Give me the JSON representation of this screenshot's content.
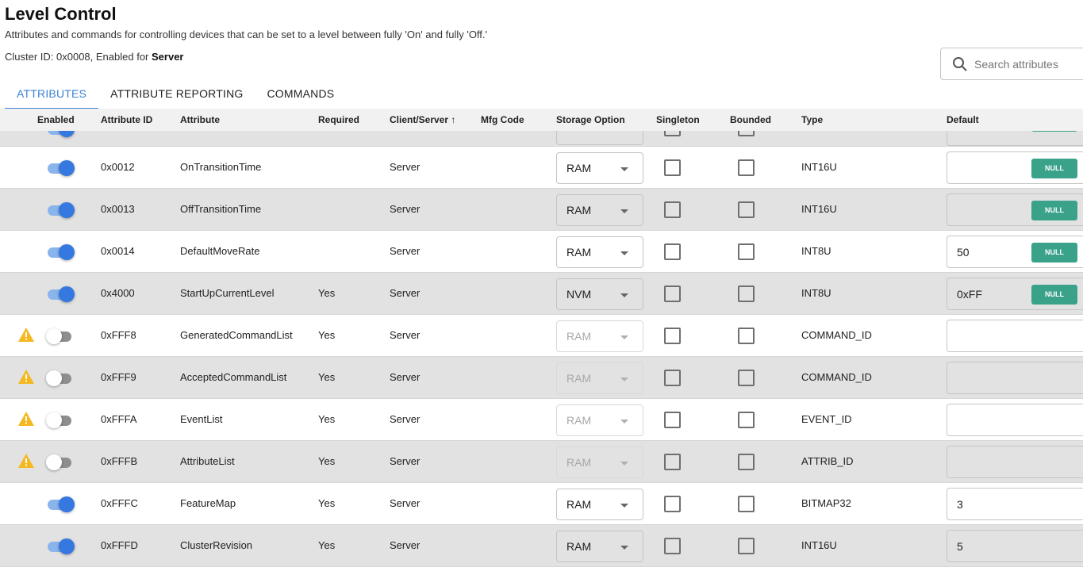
{
  "page": {
    "title": "Level Control",
    "description": "Attributes and commands for controlling devices that can be set to a level between fully 'On' and fully 'Off.'",
    "cluster_prefix": "Cluster ID: 0x0008, Enabled for ",
    "cluster_side": "Server"
  },
  "search": {
    "placeholder": "Search attributes",
    "icon": "search-icon"
  },
  "tabs": [
    {
      "label": "ATTRIBUTES",
      "active": true
    },
    {
      "label": "ATTRIBUTE REPORTING",
      "active": false
    },
    {
      "label": "COMMANDS",
      "active": false
    }
  ],
  "columns": {
    "enabled": "Enabled",
    "attribute_id": "Attribute ID",
    "attribute": "Attribute",
    "required": "Required",
    "client_server": "Client/Server ↑",
    "mfg_code": "Mfg Code",
    "storage_option": "Storage Option",
    "singleton": "Singleton",
    "bounded": "Bounded",
    "type": "Type",
    "default": "Default"
  },
  "null_label": "NULL",
  "rows": [
    {
      "enabled": true,
      "warning": false,
      "id": "0x0012",
      "name": "OnTransitionTime",
      "required": "",
      "side": "Server",
      "storage": "RAM",
      "storage_disabled": false,
      "type": "INT16U",
      "default": "",
      "null_button": true
    },
    {
      "enabled": true,
      "warning": false,
      "id": "0x0013",
      "name": "OffTransitionTime",
      "required": "",
      "side": "Server",
      "storage": "RAM",
      "storage_disabled": false,
      "type": "INT16U",
      "default": "",
      "null_button": true
    },
    {
      "enabled": true,
      "warning": false,
      "id": "0x0014",
      "name": "DefaultMoveRate",
      "required": "",
      "side": "Server",
      "storage": "RAM",
      "storage_disabled": false,
      "type": "INT8U",
      "default": "50",
      "null_button": true
    },
    {
      "enabled": true,
      "warning": false,
      "id": "0x4000",
      "name": "StartUpCurrentLevel",
      "required": "Yes",
      "side": "Server",
      "storage": "NVM",
      "storage_disabled": false,
      "type": "INT8U",
      "default": "0xFF",
      "null_button": true
    },
    {
      "enabled": false,
      "warning": true,
      "id": "0xFFF8",
      "name": "GeneratedCommandList",
      "required": "Yes",
      "side": "Server",
      "storage": "RAM",
      "storage_disabled": true,
      "type": "COMMAND_ID",
      "default": "",
      "null_button": false
    },
    {
      "enabled": false,
      "warning": true,
      "id": "0xFFF9",
      "name": "AcceptedCommandList",
      "required": "Yes",
      "side": "Server",
      "storage": "RAM",
      "storage_disabled": true,
      "type": "COMMAND_ID",
      "default": "",
      "null_button": false
    },
    {
      "enabled": false,
      "warning": true,
      "id": "0xFFFA",
      "name": "EventList",
      "required": "Yes",
      "side": "Server",
      "storage": "RAM",
      "storage_disabled": true,
      "type": "EVENT_ID",
      "default": "",
      "null_button": false
    },
    {
      "enabled": false,
      "warning": true,
      "id": "0xFFFB",
      "name": "AttributeList",
      "required": "Yes",
      "side": "Server",
      "storage": "RAM",
      "storage_disabled": true,
      "type": "ATTRIB_ID",
      "default": "",
      "null_button": false
    },
    {
      "enabled": true,
      "warning": false,
      "id": "0xFFFC",
      "name": "FeatureMap",
      "required": "Yes",
      "side": "Server",
      "storage": "RAM",
      "storage_disabled": false,
      "type": "BITMAP32",
      "default": "3",
      "null_button": false
    },
    {
      "enabled": true,
      "warning": false,
      "id": "0xFFFD",
      "name": "ClusterRevision",
      "required": "Yes",
      "side": "Server",
      "storage": "RAM",
      "storage_disabled": false,
      "type": "INT16U",
      "default": "5",
      "null_button": false
    }
  ]
}
